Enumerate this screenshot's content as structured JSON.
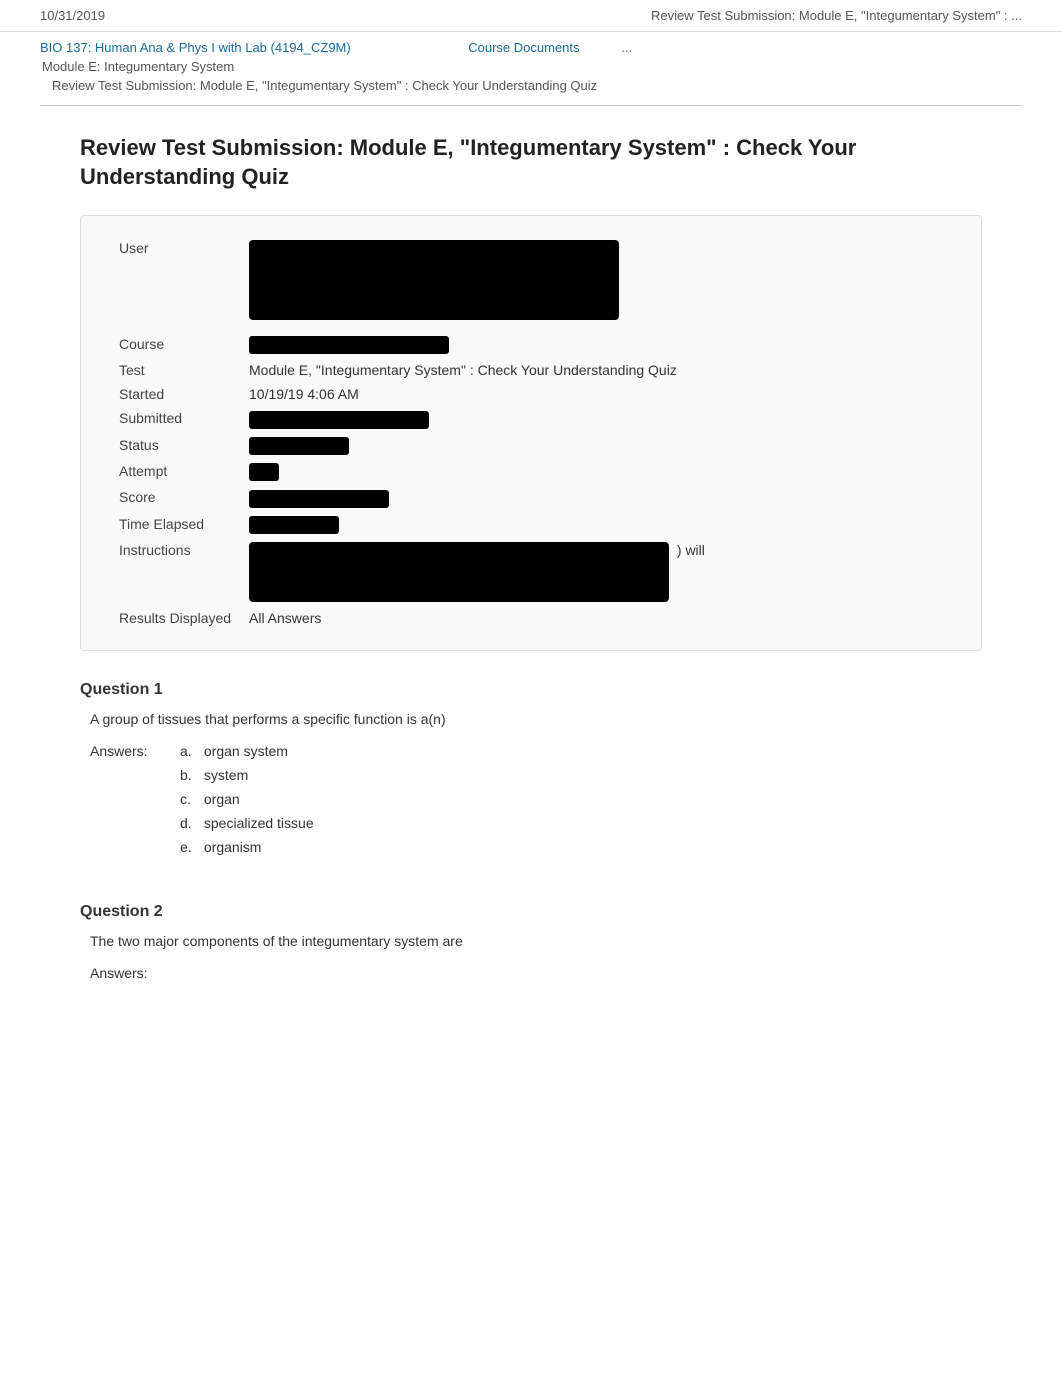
{
  "topbar": {
    "date": "10/31/2019",
    "title": "Review Test Submission: Module E, \"Integumentary System\" : ..."
  },
  "breadcrumb": {
    "course": "BIO 137: Human Ana & Phys I with Lab (4194_CZ9M)",
    "nav1": "Course Documents",
    "nav2": "...",
    "level2": "Module E: Integumentary System",
    "level3": "Review Test Submission: Module E, \"Integumentary System\" : Check Your Understanding Quiz"
  },
  "page": {
    "title": "Review Test Submission: Module E, \"Integumentary System\" : Check Your Understanding Quiz"
  },
  "info_rows": {
    "user_label": "User",
    "course_label": "Course",
    "test_label": "Test",
    "test_value": "Module E, \"Integumentary System\" : Check Your Understanding Quiz",
    "started_label": "Started",
    "started_value": "10/19/19 4:06 AM",
    "submitted_label": "Submitted",
    "status_label": "Status",
    "attempt_label": "Attempt",
    "score_label": "Score",
    "time_label": "Time Elapsed",
    "instructions_label": "Instructions",
    "instructions_suffix": ") will",
    "results_label": "Results Displayed",
    "results_value": "All Answers"
  },
  "questions": [
    {
      "label": "Question 1",
      "text": "A group of tissues that performs a specific function is a(n)",
      "answers_label": "Answers:",
      "answers": [
        {
          "letter": "a.",
          "text": "organ system"
        },
        {
          "letter": "b.",
          "text": "system"
        },
        {
          "letter": "c.",
          "text": "organ"
        },
        {
          "letter": "d.",
          "text": "specialized tissue"
        },
        {
          "letter": "e.",
          "text": "organism"
        }
      ]
    },
    {
      "label": "Question 2",
      "text": "The two major components of the integumentary system are",
      "answers_label": "Answers:",
      "answers": []
    }
  ]
}
